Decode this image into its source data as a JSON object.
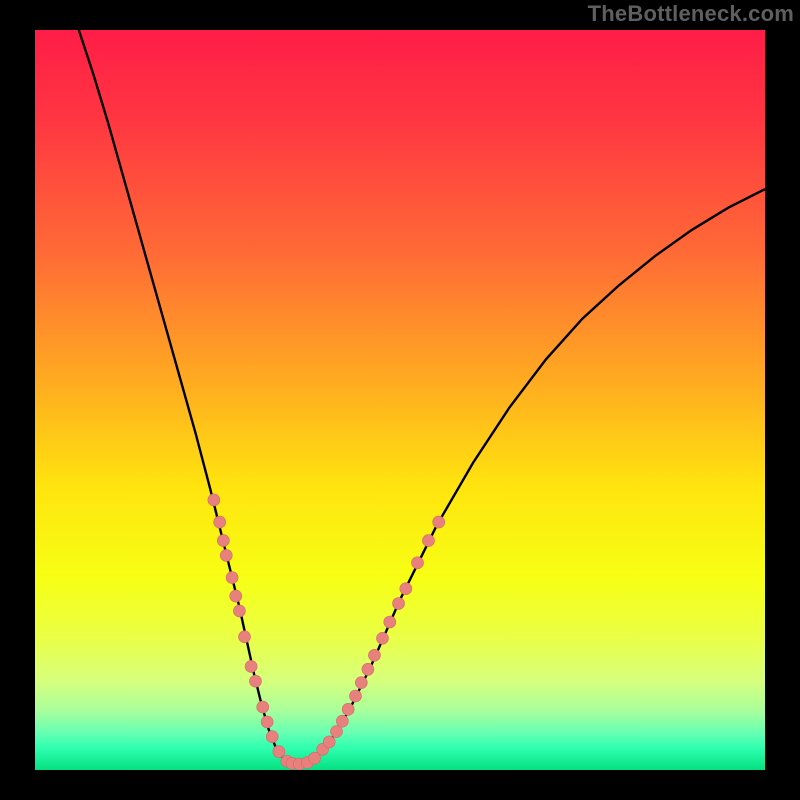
{
  "watermark": "TheBottleneck.com",
  "colors": {
    "frame": "#000000",
    "watermark": "#5f5f5f",
    "gradient_stops": [
      {
        "offset": 0.0,
        "color": "#ff1d47"
      },
      {
        "offset": 0.12,
        "color": "#ff3642"
      },
      {
        "offset": 0.3,
        "color": "#ff6a36"
      },
      {
        "offset": 0.48,
        "color": "#ffad20"
      },
      {
        "offset": 0.62,
        "color": "#ffe50e"
      },
      {
        "offset": 0.74,
        "color": "#f7ff14"
      },
      {
        "offset": 0.82,
        "color": "#eaff45"
      },
      {
        "offset": 0.88,
        "color": "#d6ff7d"
      },
      {
        "offset": 0.92,
        "color": "#a8ff9b"
      },
      {
        "offset": 0.95,
        "color": "#66ffb2"
      },
      {
        "offset": 0.97,
        "color": "#2fffb0"
      },
      {
        "offset": 1.0,
        "color": "#05e081"
      }
    ],
    "curve": "#000000",
    "marker_fill": "#e8807e",
    "marker_stroke": "#d06967"
  },
  "chart_data": {
    "type": "line",
    "title": "",
    "xlabel": "",
    "ylabel": "",
    "xlim": [
      0,
      100
    ],
    "ylim": [
      0,
      100
    ],
    "axes_visible": false,
    "grid": false,
    "series": [
      {
        "name": "bottleneck-curve",
        "x": [
          6,
          8,
          10,
          12,
          14,
          16,
          18,
          20,
          22,
          24,
          26,
          28,
          29,
          30,
          31,
          32,
          33,
          34,
          35,
          36,
          38,
          40,
          43,
          46,
          50,
          55,
          60,
          65,
          70,
          75,
          80,
          85,
          90,
          95,
          100
        ],
        "y": [
          100,
          94,
          87.5,
          80.5,
          73.5,
          66.5,
          59.5,
          52.5,
          45.5,
          38,
          30,
          22,
          17.5,
          13,
          9,
          5.5,
          3,
          1.6,
          0.9,
          0.8,
          1.3,
          3.2,
          8,
          14,
          23,
          33,
          41.5,
          49,
          55.5,
          61,
          65.5,
          69.5,
          73,
          76,
          78.5
        ]
      }
    ],
    "markers": [
      {
        "x": 24.5,
        "y": 36.5,
        "r": 6
      },
      {
        "x": 25.3,
        "y": 33.5,
        "r": 6
      },
      {
        "x": 25.8,
        "y": 31,
        "r": 6
      },
      {
        "x": 26.2,
        "y": 29,
        "r": 6
      },
      {
        "x": 27.0,
        "y": 26,
        "r": 6
      },
      {
        "x": 27.5,
        "y": 23.5,
        "r": 6
      },
      {
        "x": 28.0,
        "y": 21.5,
        "r": 6
      },
      {
        "x": 28.7,
        "y": 18,
        "r": 6
      },
      {
        "x": 29.6,
        "y": 14,
        "r": 6
      },
      {
        "x": 30.2,
        "y": 12,
        "r": 6
      },
      {
        "x": 31.2,
        "y": 8.5,
        "r": 6
      },
      {
        "x": 31.8,
        "y": 6.5,
        "r": 6
      },
      {
        "x": 32.5,
        "y": 4.5,
        "r": 6
      },
      {
        "x": 33.4,
        "y": 2.5,
        "r": 6
      },
      {
        "x": 34.5,
        "y": 1.2,
        "r": 6
      },
      {
        "x": 35.2,
        "y": 0.9,
        "r": 6
      },
      {
        "x": 36.2,
        "y": 0.8,
        "r": 6
      },
      {
        "x": 37.3,
        "y": 1.0,
        "r": 6
      },
      {
        "x": 38.3,
        "y": 1.6,
        "r": 6
      },
      {
        "x": 39.4,
        "y": 2.8,
        "r": 6
      },
      {
        "x": 40.3,
        "y": 3.8,
        "r": 6
      },
      {
        "x": 41.3,
        "y": 5.2,
        "r": 6
      },
      {
        "x": 42.1,
        "y": 6.6,
        "r": 6
      },
      {
        "x": 42.9,
        "y": 8.2,
        "r": 6
      },
      {
        "x": 43.9,
        "y": 10,
        "r": 6
      },
      {
        "x": 44.7,
        "y": 11.8,
        "r": 6
      },
      {
        "x": 45.6,
        "y": 13.6,
        "r": 6
      },
      {
        "x": 46.5,
        "y": 15.5,
        "r": 6
      },
      {
        "x": 47.6,
        "y": 17.8,
        "r": 6
      },
      {
        "x": 48.6,
        "y": 20,
        "r": 6
      },
      {
        "x": 49.8,
        "y": 22.5,
        "r": 6
      },
      {
        "x": 50.8,
        "y": 24.5,
        "r": 6
      },
      {
        "x": 52.4,
        "y": 28,
        "r": 6
      },
      {
        "x": 53.9,
        "y": 31,
        "r": 6
      },
      {
        "x": 55.3,
        "y": 33.5,
        "r": 6
      }
    ]
  }
}
